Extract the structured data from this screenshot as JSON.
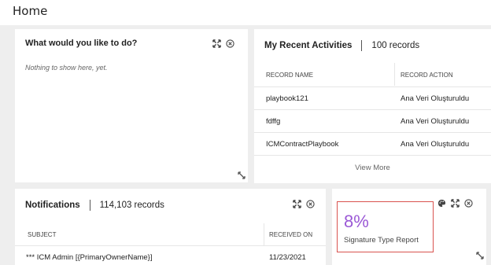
{
  "header": {
    "title": "Home"
  },
  "actions_card": {
    "title": "What would you like to do?",
    "empty_text": "Nothing to show here, yet."
  },
  "activities_card": {
    "title": "My Recent Activities",
    "count": "100 records",
    "columns": [
      "RECORD NAME",
      "RECORD ACTION"
    ],
    "rows": [
      [
        "playbook121",
        "Ana Veri Oluşturuldu"
      ],
      [
        "fdffg",
        "Ana Veri Oluşturuldu"
      ],
      [
        "ICMContractPlaybook",
        "Ana Veri Oluşturuldu"
      ]
    ],
    "view_more": "View More"
  },
  "notifications_card": {
    "title": "Notifications",
    "count": "114,103 records",
    "columns": [
      "SUBJECT",
      "RECEIVED ON"
    ],
    "rows": [
      [
        "*** ICM Admin [{PrimaryOwnerName}]",
        "11/23/2021"
      ]
    ]
  },
  "report_card": {
    "value": "8%",
    "label": "Signature Type Report",
    "value_color": "#9b59d6",
    "highlight_color": "#d9534f"
  },
  "icons": {
    "expand": "expand-icon",
    "close": "close-circle-icon",
    "palette": "palette-icon",
    "resize": "resize-handle-icon"
  }
}
